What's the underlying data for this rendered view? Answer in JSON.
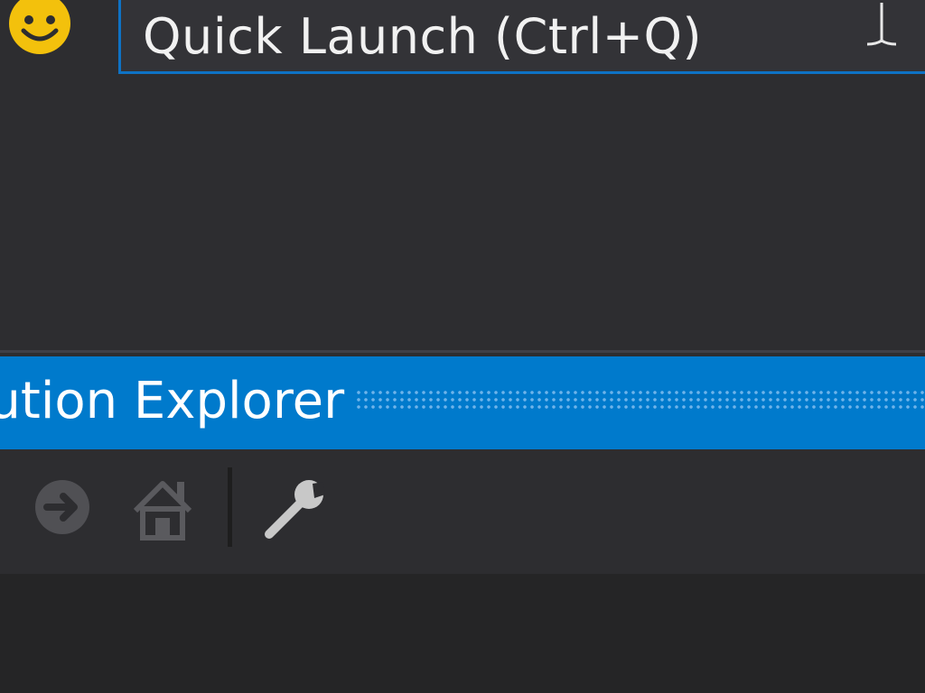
{
  "titlebar": {
    "feedback_icon": "smiley-feedback-icon"
  },
  "quick_launch": {
    "placeholder": "Quick Launch (Ctrl+Q)",
    "cursor_icon": "ibeam-cursor-icon"
  },
  "tool_window": {
    "title": "Solution Explorer"
  },
  "toolbar": {
    "buttons": [
      {
        "name": "forward",
        "icon": "forward-arrow-icon",
        "enabled": false
      },
      {
        "name": "home",
        "icon": "home-icon",
        "enabled": false
      },
      {
        "name": "properties",
        "icon": "wrench-icon",
        "enabled": true
      }
    ]
  },
  "colors": {
    "background": "#2d2d30",
    "accent": "#007acc",
    "search_border": "#0e72c4",
    "feedback_icon": "#f3c10c"
  }
}
